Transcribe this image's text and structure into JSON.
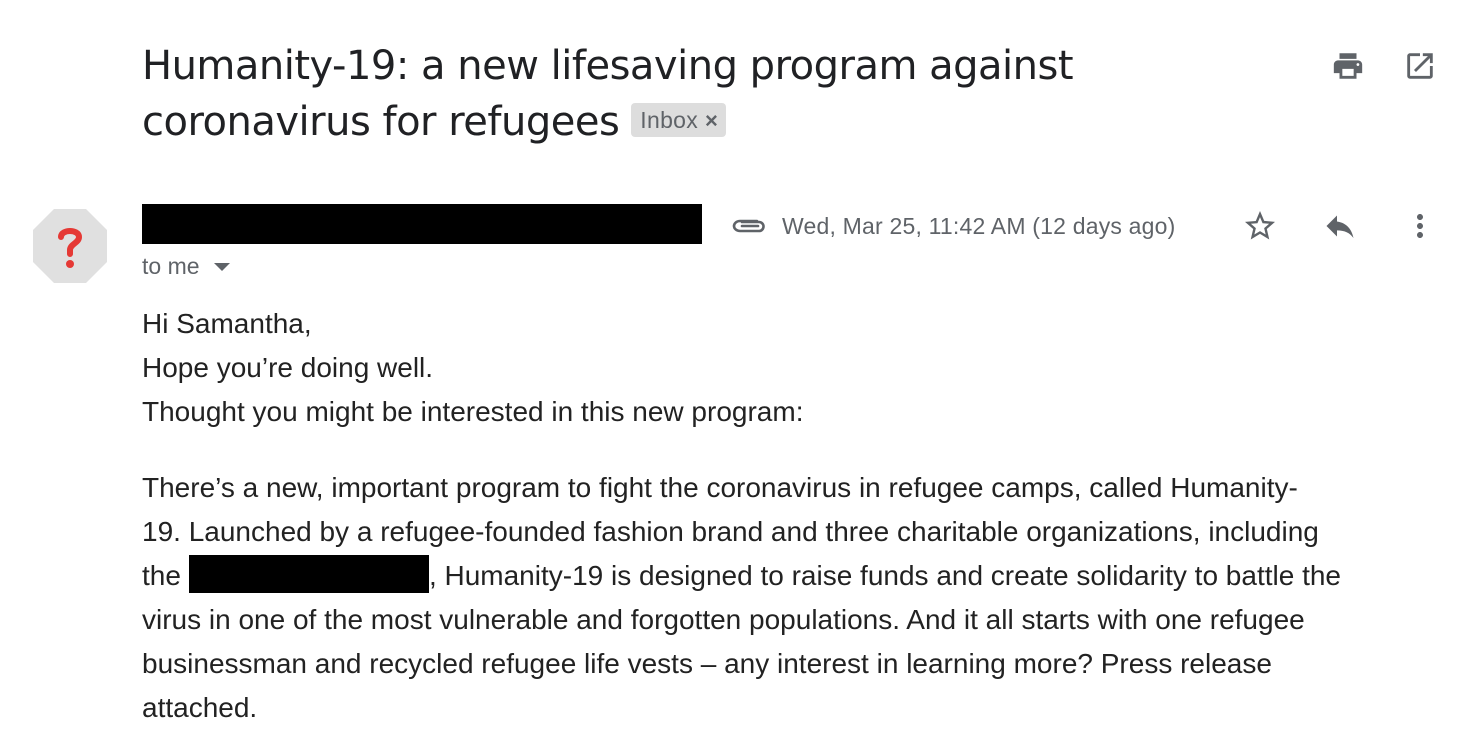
{
  "email": {
    "subject_line1": "Humanity-19: a new lifesaving program against",
    "subject_line2": "coronavirus for refugees",
    "label": "Inbox",
    "label_remove": "×",
    "recipient": "to me",
    "date": "Wed, Mar 25, 11:42 AM (12 days ago)",
    "greeting_lines": [
      "Hi Samantha,",
      "Hope you’re doing well.",
      "Thought you might be interested in this new program:"
    ],
    "paragraph": {
      "line1": "There’s a new, important program to fight the coronavirus in refugee camps, called Humanity-",
      "line2": "19. Launched by a refugee-founded fashion brand and three charitable organizations, including",
      "line3_before": "the",
      "line3_after": ", Humanity-19 is designed to raise funds and create solidarity to battle the",
      "line4": "virus in one of the most vulnerable and forgotten populations. And it all starts with one refugee",
      "line5": "businessman and recycled refugee life vests – any interest in learning more?  Press release",
      "line6": "attached."
    }
  },
  "icons": {
    "print": "print-icon",
    "open_new_window": "open-in-new-window-icon",
    "avatar": "unknown-sender-avatar-icon",
    "attachment": "paperclip-icon",
    "star": "star-icon",
    "reply": "reply-icon",
    "more": "more-vert-icon"
  },
  "colors": {
    "icon_dark": "#5f6368",
    "avatar_bg": "#e0e0e0",
    "avatar_mark": "#e53935",
    "chip_bg": "#dddddd"
  }
}
